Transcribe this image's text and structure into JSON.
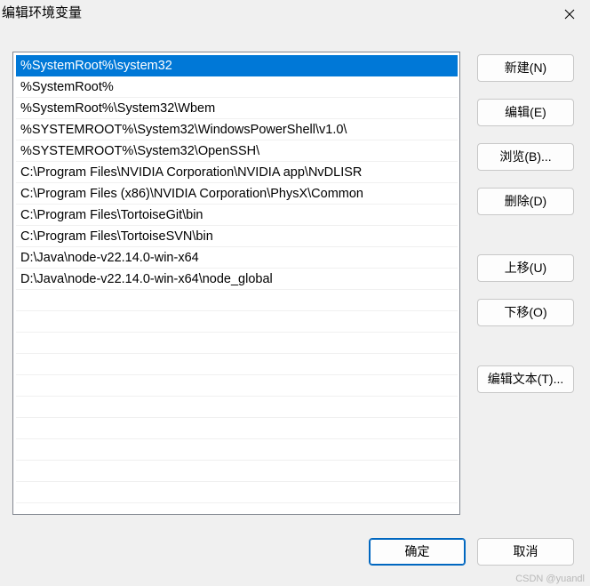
{
  "window": {
    "title": "编辑环境变量"
  },
  "paths": [
    "%SystemRoot%\\system32",
    "%SystemRoot%",
    "%SystemRoot%\\System32\\Wbem",
    "%SYSTEMROOT%\\System32\\WindowsPowerShell\\v1.0\\",
    "%SYSTEMROOT%\\System32\\OpenSSH\\",
    "C:\\Program Files\\NVIDIA Corporation\\NVIDIA app\\NvDLISR",
    "C:\\Program Files (x86)\\NVIDIA Corporation\\PhysX\\Common",
    "C:\\Program Files\\TortoiseGit\\bin",
    "C:\\Program Files\\TortoiseSVN\\bin",
    "D:\\Java\\node-v22.14.0-win-x64",
    "D:\\Java\\node-v22.14.0-win-x64\\node_global"
  ],
  "selected_index": 0,
  "buttons": {
    "new": "新建(N)",
    "edit": "编辑(E)",
    "browse": "浏览(B)...",
    "delete": "删除(D)",
    "move_up": "上移(U)",
    "move_down": "下移(O)",
    "edit_text": "编辑文本(T)...",
    "ok": "确定",
    "cancel": "取消"
  },
  "watermark": "CSDN @yuandl",
  "colors": {
    "selection": "#0078d7",
    "background": "#f0f0f0"
  }
}
